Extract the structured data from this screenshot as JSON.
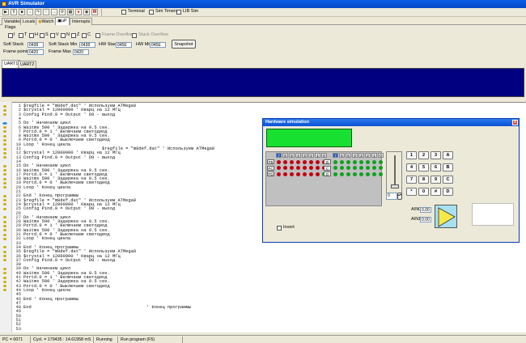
{
  "window": {
    "title": "AVR Simulator"
  },
  "toolbar": {
    "buttons": [
      {
        "name": "run-icon",
        "glyph": "▶"
      },
      {
        "name": "pause-icon",
        "glyph": "‖"
      },
      {
        "name": "stop-icon",
        "glyph": "■"
      },
      {
        "name": "step-into-icon",
        "glyph": "↓"
      },
      {
        "name": "step-over-icon",
        "glyph": "↷"
      },
      {
        "name": "step-out-icon",
        "glyph": "↑"
      },
      {
        "name": "run-to-cursor-icon",
        "glyph": "→"
      },
      {
        "name": "refresh-icon",
        "glyph": "⟳"
      },
      {
        "name": "hardware-icon",
        "glyph": "▦"
      },
      {
        "name": "breakpoint-icon",
        "glyph": "●"
      },
      {
        "name": "watch-icon",
        "glyph": "◉"
      },
      {
        "name": "memory-icon",
        "glyph": "M"
      }
    ],
    "terminal_label": "Terminal",
    "sim_timers_label": "Sim Timers",
    "lib_sim_label": "LIB Sim"
  },
  "tabs": [
    {
      "label": "Variables"
    },
    {
      "label": "Locals"
    },
    {
      "label": "Watch"
    },
    {
      "label": "uP"
    },
    {
      "label": "Interrupts"
    }
  ],
  "panel": {
    "flags_label": "Flags",
    "flags": [
      "I",
      "T",
      "H",
      "S",
      "V",
      "N",
      "Z",
      "C"
    ],
    "frame_overflow": "Frame Overflow",
    "stack_overflow": "Stack Overflow",
    "soft_stack": {
      "label": "Soft Stack",
      "value": "0438"
    },
    "soft_stack_min": {
      "label": "Soft Stack Min",
      "value": "0438"
    },
    "hw_stack": {
      "label": "HW Stack",
      "value": "045E"
    },
    "hw_min": {
      "label": "HW Min",
      "value": "045E"
    },
    "snapshot": "Snapshot",
    "frame_pointer": {
      "label": "Frame pointer",
      "value": "0420"
    },
    "frame_max": {
      "label": "Frame Max",
      "value": "0420"
    }
  },
  "uart_tabs": [
    {
      "label": "UART1"
    },
    {
      "label": "UART2"
    }
  ],
  "code": [
    {
      "n": "1",
      "text": "$regfile = \"m8def.dat\" ' Используем ATMega8"
    },
    {
      "n": "2",
      "text": "$crystal = 12000000 ' Кварц на 12 МГц"
    },
    {
      "n": "3",
      "text": "Config Pind.0 = Output ' D0 - выход"
    },
    {
      "n": "4",
      "text": ""
    },
    {
      "n": "5",
      "text": "Do ' Начинаем цикл"
    },
    {
      "n": "6",
      "text": "Waitms 500 ' Задержка на 0.5 сек."
    },
    {
      "n": "7",
      "text": "Portd.0 = 1 ' Включаем светодиод"
    },
    {
      "n": "8",
      "text": "Waitms 500 ' Задержка на 0.5 сек."
    },
    {
      "n": "9",
      "text": "Portd.0 = 0 ' Выключаем светодиод"
    },
    {
      "n": "10",
      "text": "Loop ' Конец цикла"
    },
    {
      "n": "11",
      "text": "                              $regfile = \"m8def.dat\" ' Используем ATMega8"
    },
    {
      "n": "12",
      "text": "$crystal = 12000000 ' Кварц на 12 МГц"
    },
    {
      "n": "13",
      "text": "Config Pind.0 = Output ' D0 - выход"
    },
    {
      "n": "14",
      "text": ""
    },
    {
      "n": "15",
      "text": "Do ' Начинаем цикл"
    },
    {
      "n": "16",
      "text": "Waitms 500 ' Задержка на 0.5 сек."
    },
    {
      "n": "17",
      "text": "Portd.0 = 1 ' Включаем светодиод"
    },
    {
      "n": "18",
      "text": "Waitms 500 ' Задержка на 0.5 сек."
    },
    {
      "n": "19",
      "text": "Portd.0 = 0 ' Выключаем светодиод"
    },
    {
      "n": "20",
      "text": "Loop ' Конец цикла"
    },
    {
      "n": "21",
      "text": ""
    },
    {
      "n": "22",
      "text": "End ' Конец программы"
    },
    {
      "n": "23",
      "text": "$regfile = \"m8def.dat\" ' Используем ATMega8"
    },
    {
      "n": "24",
      "text": "$crystal = 12000000 ' Кварц на 12 МГц"
    },
    {
      "n": "25",
      "text": "Config Pind.0 = Output ' D0 - выход"
    },
    {
      "n": "26",
      "text": ""
    },
    {
      "n": "27",
      "text": "Do ' Начинаем цикл"
    },
    {
      "n": "28",
      "text": "Waitms 500 ' Задержка на 0.5 сек."
    },
    {
      "n": "29",
      "text": "Portd.0 = 1 ' Включаем светодиод"
    },
    {
      "n": "30",
      "text": "Waitms 500 ' Задержка на 0.5 сек."
    },
    {
      "n": "31",
      "text": "Portd.0 = 0 ' Выключаем светодиод"
    },
    {
      "n": "32",
      "text": "Loop ' Конец цикла"
    },
    {
      "n": "33",
      "text": ""
    },
    {
      "n": "34",
      "text": "End ' Конец программы"
    },
    {
      "n": "35",
      "text": "$regfile = \"m8def.dat\" ' Используем ATMega8"
    },
    {
      "n": "36",
      "text": "$crystal = 12000000 ' Кварц на 12 МГц"
    },
    {
      "n": "37",
      "text": "Config Pind.0 = Output ' D0 - выход"
    },
    {
      "n": "38",
      "text": ""
    },
    {
      "n": "39",
      "text": "Do ' Начинаем цикл"
    },
    {
      "n": "40",
      "text": "Waitms 500 ' Задержка на 0.5 сек."
    },
    {
      "n": "41",
      "text": "Portd.0 = 1 ' Включаем светодиод"
    },
    {
      "n": "42",
      "text": "Waitms 500 ' Задержка на 0.5 сек."
    },
    {
      "n": "43",
      "text": "Portd.0 = 0 ' Выключаем светодиод"
    },
    {
      "n": "44",
      "text": "Loop ' Конец цикла"
    },
    {
      "n": "45",
      "text": ""
    },
    {
      "n": "46",
      "text": "End ' Конец программы"
    },
    {
      "n": "47",
      "text": ""
    },
    {
      "n": "48",
      "text": "End                                            ' Конец программы"
    },
    {
      "n": "49",
      "text": ""
    },
    {
      "n": "50",
      "text": ""
    },
    {
      "n": "51",
      "text": ""
    },
    {
      "n": "52",
      "text": ""
    },
    {
      "n": "53",
      "text": ""
    }
  ],
  "status": {
    "pc": "PC = 0071",
    "cycles": "Cycl. = 179435 : 14.61958 mS",
    "state": "Running",
    "hint": "Run program (F5)"
  },
  "hw": {
    "title": "Hardware simulation",
    "close_glyph": "x",
    "pin_numbers": [
      "7",
      "6",
      "5",
      "4",
      "3",
      "2",
      "1",
      "0"
    ],
    "ports_left": [
      "PB",
      "PC",
      "PD"
    ],
    "ports_right": [
      "B",
      "C",
      "D"
    ],
    "slider_value": "0",
    "keypad": [
      "1",
      "2",
      "3",
      "A",
      "4",
      "5",
      "6",
      "B",
      "7",
      "8",
      "9",
      "C",
      "*",
      "0",
      "#",
      "D"
    ],
    "invert_label": "Invert",
    "ain0": {
      "label": "AIN0",
      "value": "0.00"
    },
    "ain1": {
      "label": "AIN1",
      "value": "0.00"
    }
  },
  "colors": {
    "uart_bg": "#000080",
    "lcd": "#18e030",
    "led_on": "#c00010",
    "led_off": "#10a020"
  }
}
